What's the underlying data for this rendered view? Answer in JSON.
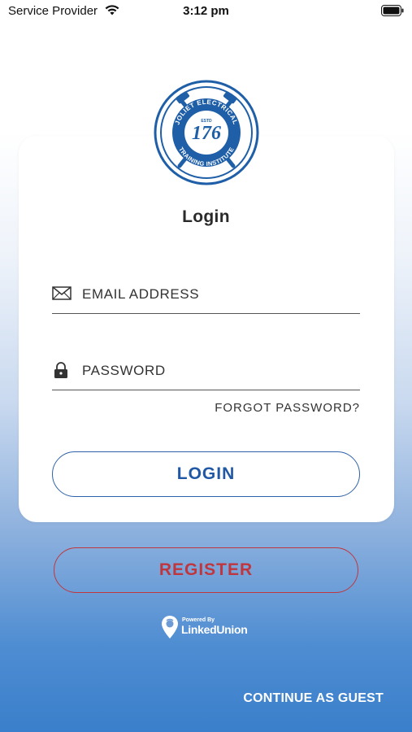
{
  "status_bar": {
    "carrier": "Service Provider",
    "time": "3:12 pm"
  },
  "logo": {
    "arc_top": "JOLIET ELECTRICAL",
    "arc_bottom": "TRAINING INSTITUTE",
    "number": "176",
    "estd": "ESTD",
    "icon": "union-seal-logo"
  },
  "login": {
    "title": "Login",
    "email_placeholder": "EMAIL ADDRESS",
    "email_value": "",
    "password_placeholder": "PASSWORD",
    "password_value": "",
    "forgot_label": "FORGOT PASSWORD?",
    "login_label": "LOGIN"
  },
  "register_label": "REGISTER",
  "powered_by": {
    "small": "Powered By",
    "brand": "LinkedUnion"
  },
  "guest_label": "CONTINUE AS GUEST",
  "colors": {
    "login_accent": "#2058a5",
    "register_accent": "#c0363e",
    "gradient_bottom": "#3a7fcb"
  }
}
